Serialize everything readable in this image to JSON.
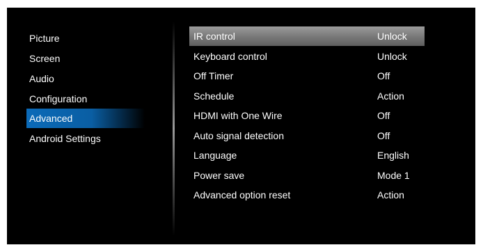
{
  "left_menu": {
    "items": [
      {
        "label": "Picture"
      },
      {
        "label": "Screen"
      },
      {
        "label": "Audio"
      },
      {
        "label": "Configuration"
      },
      {
        "label": "Advanced"
      },
      {
        "label": "Android Settings"
      }
    ],
    "selected_item": "Advanced"
  },
  "settings": {
    "rows": [
      {
        "label": "IR control",
        "value": "Unlock"
      },
      {
        "label": "Keyboard control",
        "value": "Unlock"
      },
      {
        "label": "Off Timer",
        "value": "Off"
      },
      {
        "label": "Schedule",
        "value": "Action"
      },
      {
        "label": "HDMI with One Wire",
        "value": "Off"
      },
      {
        "label": "Auto signal detection",
        "value": "Off"
      },
      {
        "label": "Language",
        "value": "English"
      },
      {
        "label": "Power save",
        "value": "Mode 1"
      },
      {
        "label": "Advanced option reset",
        "value": "Action"
      }
    ],
    "selected_row": "IR control"
  },
  "colors": {
    "background": "#000000",
    "text": "#ffffff",
    "selected_left": "#0b6ab8",
    "selected_right": "#8a8a8a"
  }
}
